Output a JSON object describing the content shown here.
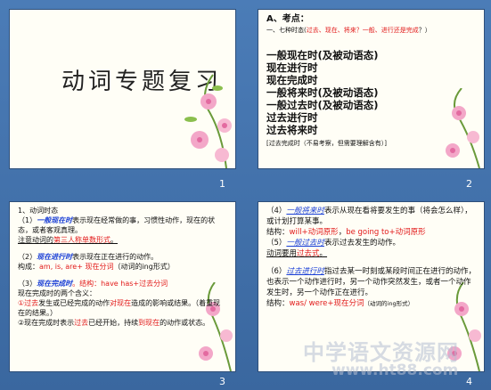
{
  "slides": [
    {
      "number": "1",
      "title": "动词专题复习"
    },
    {
      "number": "2",
      "heading": "A、考点：",
      "intro_a": "一、七种时态(",
      "intro_red": "过去、现在、将来？一般、进行还是完成",
      "intro_b": "？）",
      "items": [
        "一般现在时(及被动语态)",
        "现在进行时",
        "现在完成时",
        "一般将来时(及被动语态)",
        "一般过去时(及被动语态)",
        "过去进行时",
        "过去将来时"
      ],
      "note": "[过去完成时（不易考察，但需要理解含有）]"
    },
    {
      "number": "3",
      "l1": "1、动词时态",
      "l2a": "（1）",
      "l2b": "一般现在时",
      "l2c": "表示现在经常做的事，习惯性动作，现在的状态，或者客观真理。",
      "l3a": "注意动词的",
      "l3b": "第三人称单数形式",
      "l3c": "。",
      "l4a": "（2）",
      "l4b": "现在进行时",
      "l4c": "表示现在正在进行的动作。",
      "l5a": "构成：",
      "l5b": "am, is, are+ 现在分词",
      "l5c": "（动词的ing形式）",
      "l6a": "（3）",
      "l6b": "现在完成时",
      "l6c": "。结构：have has+过去分词",
      "l7": "现在完成时的两个含义：",
      "l8a": "①",
      "l8b": "过去",
      "l8c": "发生或已经完成的动作",
      "l8d": "对现在",
      "l8e": "造成的影响或结果。（着重现在的结果。）",
      "l9a": "②现在完成时表示",
      "l9b": "过去",
      "l9c": "已经开始，持续",
      "l9d": "到现在",
      "l9e": "的动作或状态。"
    },
    {
      "number": "4",
      "p1a": "（4）",
      "p1b": "一般将来时",
      "p1c": "表示从现在看将要发生的事（将会怎么样），或计划打算某事。",
      "p2a": "结构：",
      "p2b": "will+动词原形",
      "p2c": "，",
      "p2d": "be going to+动词原形",
      "p3a": "（5）",
      "p3b": "一般过去时",
      "p3c": "表示过去发生的动作。",
      "p4a": "动词要用",
      "p4b": "过去式",
      "p4c": "。",
      "p5a": "（6）",
      "p5b": "过去进行时",
      "p5c": "指过去某一时刻或某段时间正在进行的动作，也表示一个动作进行时，另一个动作突然发生，或者一个动作发生时，另一个动作正在进行。",
      "p6a": "结构：",
      "p6b": "was/ were+现在分词",
      "p6c": "（动词的ing形式）"
    }
  ],
  "watermark": {
    "cn": "中学语文资源网",
    "url": "www.ht88.com"
  }
}
